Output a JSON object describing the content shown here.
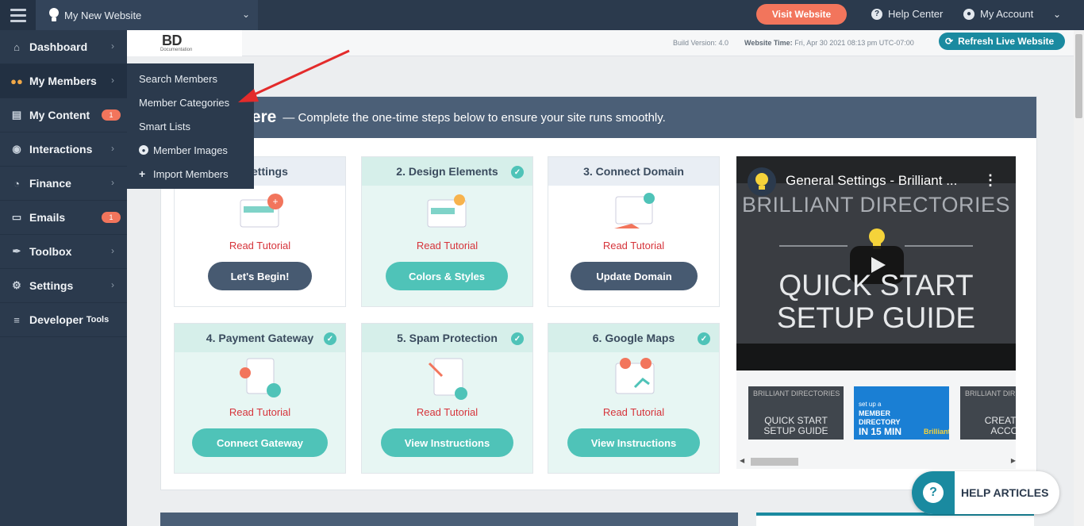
{
  "topbar": {
    "site_name": "My New Website",
    "visit_label": "Visit Website",
    "help_label": "Help Center",
    "account_label": "My Account"
  },
  "sidebar": {
    "items": [
      {
        "label": "Dashboard",
        "icon": "home-icon"
      },
      {
        "label": "My Members",
        "icon": "users-icon"
      },
      {
        "label": "My Content",
        "icon": "folder-icon",
        "badge": "1"
      },
      {
        "label": "Interactions",
        "icon": "comments-icon"
      },
      {
        "label": "Finance",
        "icon": "pie-chart-icon"
      },
      {
        "label": "Emails",
        "icon": "inbox-icon",
        "badge": "1"
      },
      {
        "label": "Toolbox",
        "icon": "wrench-icon"
      },
      {
        "label": "Settings",
        "icon": "gear-icon"
      },
      {
        "label": "Developer",
        "label_small": "Tools",
        "icon": "sliders-icon"
      }
    ]
  },
  "dropdown": {
    "items": [
      "Search Members",
      "Member Categories",
      "Smart Lists",
      "Member Images",
      "Import Members"
    ]
  },
  "header": {
    "logo": "BD",
    "logo_sub": "Documentation",
    "build_label": "Build Version: 4.0",
    "time_label": "Website Time:",
    "time_value": "Fri, Apr 30 2021 08:13 pm UTC-07:00",
    "refresh_label": "Refresh Live Website"
  },
  "panel": {
    "title": "lere",
    "subtitle": "— Complete the one-time steps below to ensure your site runs smoothly."
  },
  "cards": [
    {
      "title": "al Settings",
      "link": "Read Tutorial",
      "button": "Let's Begin!",
      "done": false
    },
    {
      "title": "2. Design Elements",
      "link": "Read Tutorial",
      "button": "Colors & Styles",
      "done": true
    },
    {
      "title": "3. Connect Domain",
      "link": "Read Tutorial",
      "button": "Update Domain",
      "done": false
    },
    {
      "title": "4. Payment Gateway",
      "link": "Read Tutorial",
      "button": "Connect Gateway",
      "done": true
    },
    {
      "title": "5. Spam Protection",
      "link": "Read Tutorial",
      "button": "View Instructions",
      "done": true
    },
    {
      "title": "6. Google Maps",
      "link": "Read Tutorial",
      "button": "View Instructions",
      "done": true
    }
  ],
  "video": {
    "title": "General Settings - Brilliant ...",
    "brand": "BRILLIANT DIRECTORIES",
    "line1": "QUICK START",
    "line2": "SETUP GUIDE"
  },
  "thumbs": [
    {
      "top": "BRILLIANT DIRECTORIES",
      "l1": "QUICK START",
      "l2": "SETUP GUIDE"
    },
    {
      "small": "set up a",
      "mid1": "MEMBER",
      "mid2": "DIRECTORY",
      "big": "IN 15 MIN",
      "brand": "Brilliant"
    },
    {
      "top": "BRILLIANT DIRECTORIES",
      "l1": "CREATE A",
      "l2": "ACCOU"
    }
  ],
  "help": {
    "label": "HELP ARTICLES"
  },
  "colors": {
    "accent": "#f2755c",
    "teal": "#4fc3b8",
    "navy": "#2b3a4d",
    "refresh": "#1a8aa0",
    "link_red": "#d6343b"
  }
}
